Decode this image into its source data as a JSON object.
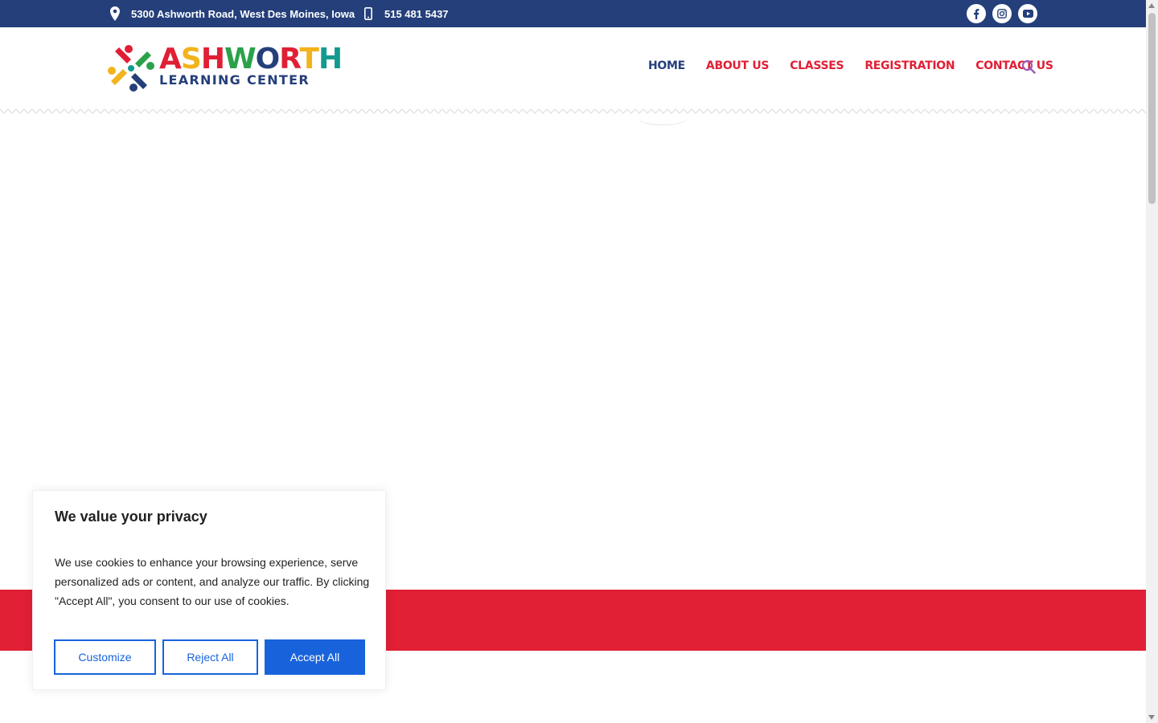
{
  "topbar": {
    "address": "5300 Ashworth Road, West Des Moines, Iowa",
    "phone": "515 481 5437",
    "social": [
      "facebook-icon",
      "instagram-icon",
      "youtube-icon"
    ]
  },
  "logo": {
    "title_letters": [
      {
        "ch": "A",
        "color": "#e01f35"
      },
      {
        "ch": "S",
        "color": "#f2b31b"
      },
      {
        "ch": "H",
        "color": "#e01f35"
      },
      {
        "ch": "W",
        "color": "#2aa24a"
      },
      {
        "ch": "O",
        "color": "#243f7a"
      },
      {
        "ch": "R",
        "color": "#e01f35"
      },
      {
        "ch": "T",
        "color": "#f2b31b"
      },
      {
        "ch": "H",
        "color": "#139a8f"
      }
    ],
    "subtitle": "LEARNING CENTER"
  },
  "nav": {
    "items": [
      {
        "label": "HOME",
        "active": true
      },
      {
        "label": "ABOUT US",
        "active": false
      },
      {
        "label": "CLASSES",
        "active": false
      },
      {
        "label": "REGISTRATION",
        "active": false
      },
      {
        "label": "CONTACT US",
        "active": false
      }
    ]
  },
  "cookie": {
    "title": "We value your privacy",
    "text": "We use cookies to enhance your browsing experience, serve personalized ads or content, and analyze our traffic. By clicking \"Accept All\", you consent to our use of cookies.",
    "customize_label": "Customize",
    "reject_label": "Reject All",
    "accept_label": "Accept All"
  },
  "colors": {
    "navy": "#243f7a",
    "red": "#e11f35",
    "cookie_blue": "#1863dc",
    "search_purple": "#9b59b6"
  }
}
